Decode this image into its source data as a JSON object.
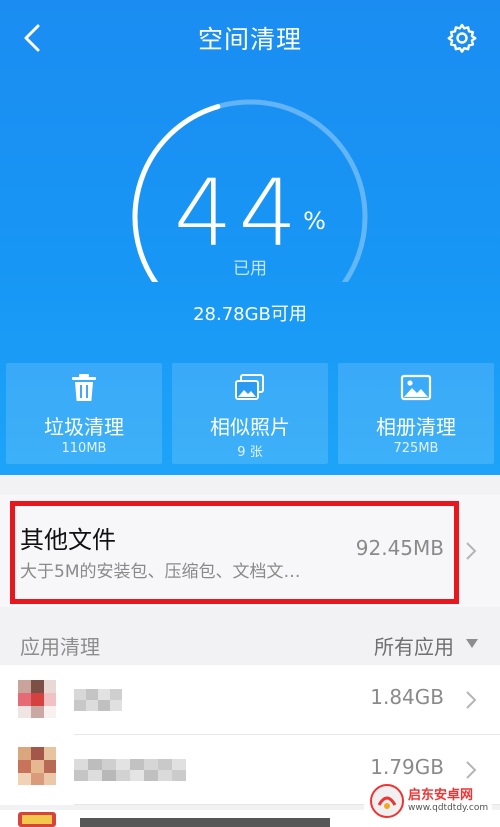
{
  "header": {
    "title": "空间清理"
  },
  "storage": {
    "percent": "44",
    "percent_sign": "%",
    "used_label": "已用",
    "available": "28.78GB可用",
    "used_fraction": 0.44
  },
  "cards": [
    {
      "label": "垃圾清理",
      "sub": "110MB",
      "icon": "trash-icon"
    },
    {
      "label": "相似照片",
      "sub": "9 张",
      "icon": "photos-icon"
    },
    {
      "label": "相册清理",
      "sub": "725MB",
      "icon": "album-icon"
    }
  ],
  "other_files": {
    "title": "其他文件",
    "description": "大于5M的安装包、压缩包、文档文…",
    "size": "92.45MB"
  },
  "app_section": {
    "title": "应用清理",
    "filter": "所有应用"
  },
  "apps": [
    {
      "size": "1.84GB"
    },
    {
      "size": "1.79GB"
    }
  ],
  "watermark": {
    "text": "启东安卓网",
    "url": "www.qdtdtdy.com"
  },
  "colors": {
    "hero_blue": "#1b8df2",
    "highlight_red": "#e8161d"
  }
}
